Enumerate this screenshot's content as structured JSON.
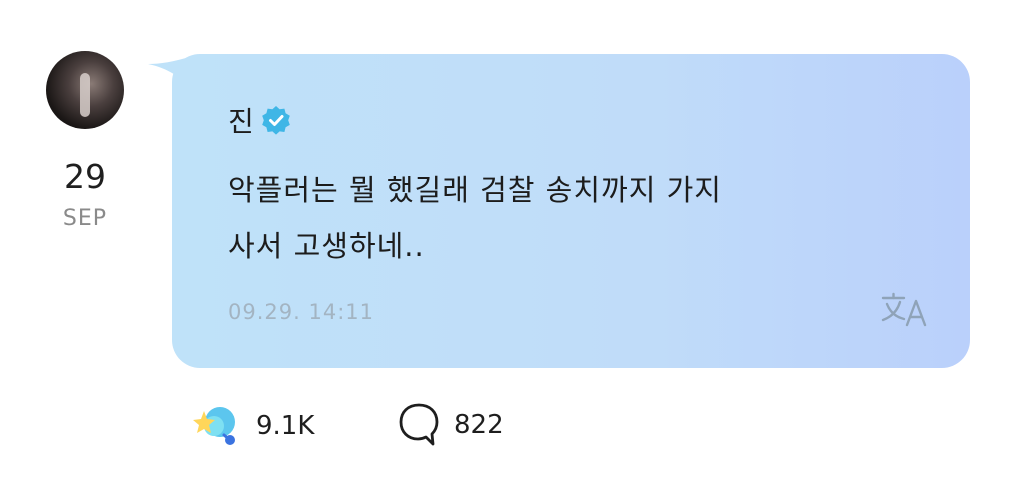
{
  "post": {
    "author": "진",
    "date": {
      "day": "29",
      "month": "SEP"
    },
    "text_lines": [
      "악플러는 뭘 했길래 검찰 송치까지 가지",
      "사서 고생하네.."
    ],
    "timestamp": "09.29. 14:11"
  },
  "reactions": {
    "likes_count": "9.1K",
    "comments_count": "822"
  },
  "colors": {
    "bubble_start": "#bfe2f9",
    "bubble_end": "#bad0fb",
    "verified_badge": "#3fb6e6",
    "timestamp": "#a3b4c2"
  },
  "icons": [
    "verified-badge-icon",
    "translate-icon",
    "like-reaction-icon",
    "comment-icon"
  ]
}
